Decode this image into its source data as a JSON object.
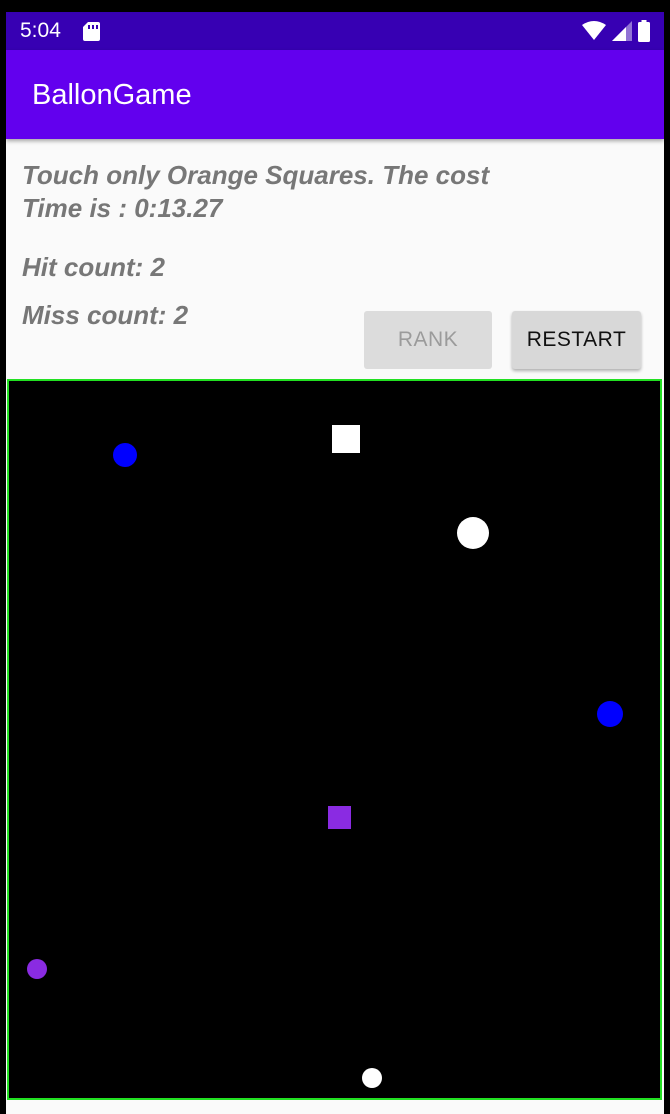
{
  "status_bar": {
    "time": "5:04",
    "icons": [
      "sd-card-icon",
      "wifi-icon",
      "signal-icon",
      "battery-icon"
    ]
  },
  "app_bar": {
    "title": "BallonGame",
    "color": "#6200ee"
  },
  "info": {
    "instruction": "Touch only Orange Squares. The cost",
    "time": "Time is : 0:13.27",
    "hit_count": "Hit count: 2",
    "miss_count": "Miss count: 2"
  },
  "buttons": {
    "rank_label": "RANK",
    "rank_enabled": false,
    "restart_label": "RESTART"
  },
  "game": {
    "background": "#000000",
    "border_color": "#22e022",
    "objects": [
      {
        "type": "circle",
        "color": "#0000ff"
      },
      {
        "type": "square",
        "color": "#ffffff"
      },
      {
        "type": "circle",
        "color": "#ffffff"
      },
      {
        "type": "circle",
        "color": "#0000ff"
      },
      {
        "type": "square",
        "color": "#8a2be2"
      },
      {
        "type": "circle",
        "color": "#8a2be2"
      },
      {
        "type": "circle",
        "color": "#ffffff"
      }
    ]
  }
}
